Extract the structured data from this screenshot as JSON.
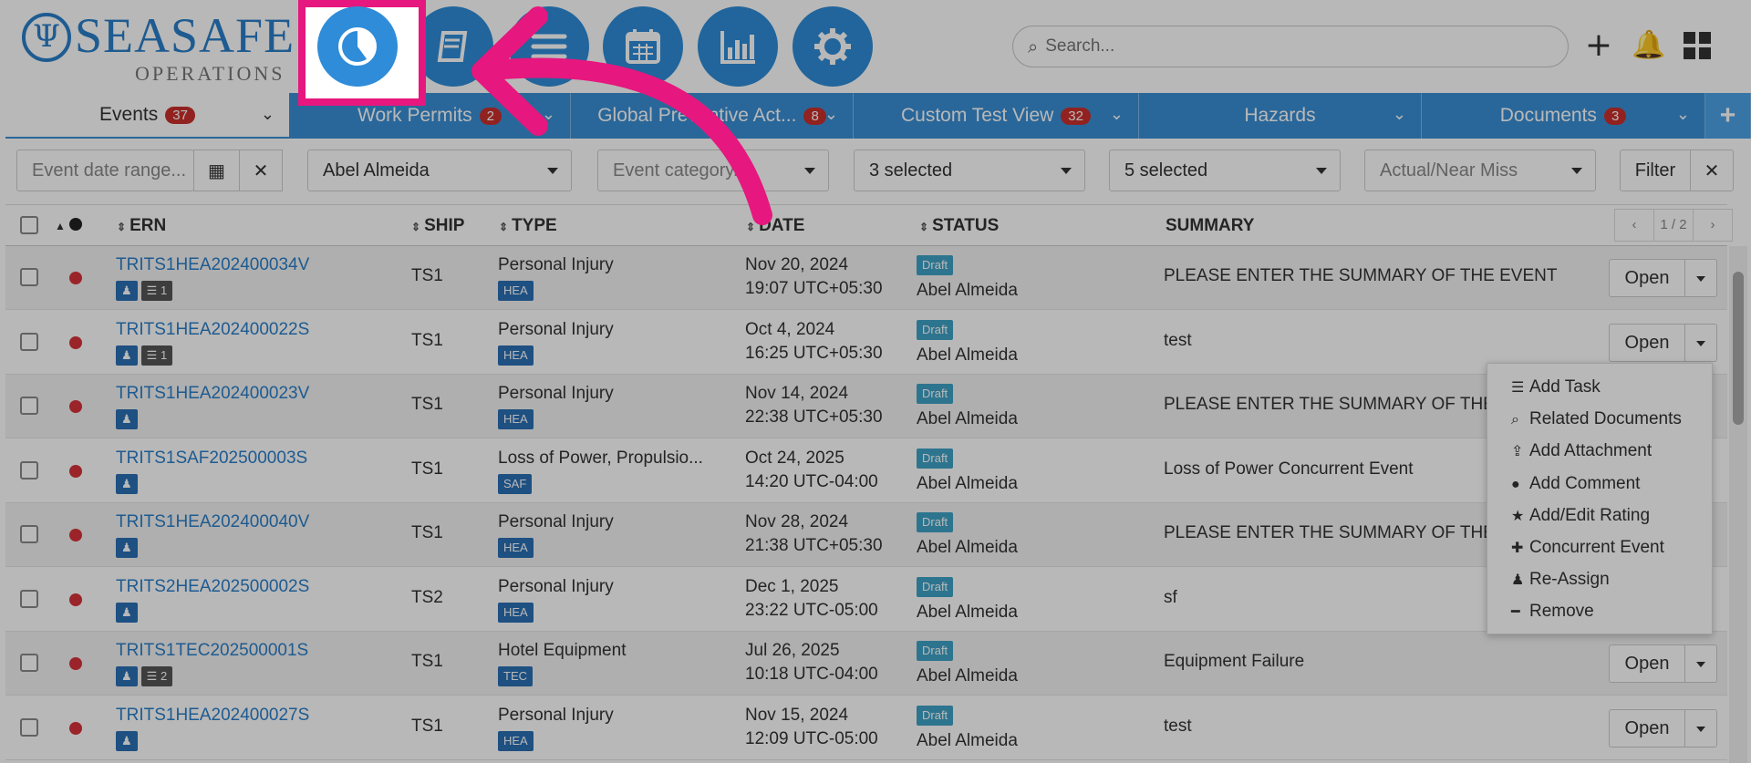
{
  "brand": {
    "name": "SEASAFE",
    "sub": "OPERATIONS"
  },
  "nav_icons": [
    "dashboard-pie-icon",
    "logbook-icon",
    "list-icon",
    "calendar-icon",
    "bar-chart-icon",
    "settings-gear-icon"
  ],
  "search": {
    "placeholder": "Search..."
  },
  "tabs": [
    {
      "label": "Events",
      "count": "37"
    },
    {
      "label": "Work Permits",
      "count": "2"
    },
    {
      "label": "Global Preventive Act...",
      "count": "8"
    },
    {
      "label": "Custom Test View",
      "count": "32"
    },
    {
      "label": "Hazards",
      "count": ""
    },
    {
      "label": "Documents",
      "count": "3"
    }
  ],
  "filters": {
    "date_placeholder": "Event date range...",
    "person": "Abel Almeida",
    "category_placeholder": "Event category...",
    "sel1": "3 selected",
    "sel2": "5 selected",
    "actual_placeholder": "Actual/Near Miss",
    "filter_label": "Filter"
  },
  "columns": {
    "ern": "ERN",
    "ship": "SHIP",
    "type": "TYPE",
    "date": "DATE",
    "status": "STATUS",
    "summary": "SUMMARY"
  },
  "pager": {
    "prev": "‹",
    "pages": "1 / 2",
    "next": "›"
  },
  "rows": [
    {
      "ern": "TRITS1HEA202400034V",
      "ship": "TS1",
      "type": "Personal Injury",
      "type_code": "HEA",
      "date": "Nov 20, 2024",
      "time": "19:07 UTC+05:30",
      "status": "Draft",
      "owner": "Abel Almeida",
      "summary": "PLEASE ENTER THE SUMMARY OF THE EVENT",
      "attach": "1",
      "open": "Open"
    },
    {
      "ern": "TRITS1HEA202400022S",
      "ship": "TS1",
      "type": "Personal Injury",
      "type_code": "HEA",
      "date": "Oct 4, 2024",
      "time": "16:25 UTC+05:30",
      "status": "Draft",
      "owner": "Abel Almeida",
      "summary": "test",
      "attach": "1",
      "open": "Open"
    },
    {
      "ern": "TRITS1HEA202400023V",
      "ship": "TS1",
      "type": "Personal Injury",
      "type_code": "HEA",
      "date": "Nov 14, 2024",
      "time": "22:38 UTC+05:30",
      "status": "Draft",
      "owner": "Abel Almeida",
      "summary": "PLEASE ENTER THE SUMMARY OF THE EV",
      "attach": "",
      "open": ""
    },
    {
      "ern": "TRITS1SAF202500003S",
      "ship": "TS1",
      "type": "Loss of Power, Propulsio...",
      "type_code": "SAF",
      "date": "Oct 24, 2025",
      "time": "14:20 UTC-04:00",
      "status": "Draft",
      "owner": "Abel Almeida",
      "summary": "Loss of Power Concurrent Event",
      "attach": "",
      "open": ""
    },
    {
      "ern": "TRITS1HEA202400040V",
      "ship": "TS1",
      "type": "Personal Injury",
      "type_code": "HEA",
      "date": "Nov 28, 2024",
      "time": "21:38 UTC+05:30",
      "status": "Draft",
      "owner": "Abel Almeida",
      "summary": "PLEASE ENTER THE SUMMARY OF THE EV",
      "attach": "",
      "open": ""
    },
    {
      "ern": "TRITS2HEA202500002S",
      "ship": "TS2",
      "type": "Personal Injury",
      "type_code": "HEA",
      "date": "Dec 1, 2025",
      "time": "23:22 UTC-05:00",
      "status": "Draft",
      "owner": "Abel Almeida",
      "summary": "sf",
      "attach": "",
      "open": ""
    },
    {
      "ern": "TRITS1TEC202500001S",
      "ship": "TS1",
      "type": "Hotel Equipment",
      "type_code": "TEC",
      "date": "Jul 26, 2025",
      "time": "10:18 UTC-04:00",
      "status": "Draft",
      "owner": "Abel Almeida",
      "summary": "Equipment Failure",
      "attach": "2",
      "open": "Open"
    },
    {
      "ern": "TRITS1HEA202400027S",
      "ship": "TS1",
      "type": "Personal Injury",
      "type_code": "HEA",
      "date": "Nov 15, 2024",
      "time": "12:09 UTC-05:00",
      "status": "Draft",
      "owner": "Abel Almeida",
      "summary": "test",
      "attach": "",
      "open": "Open"
    }
  ],
  "menu": [
    {
      "icon": "task-icon",
      "glyph": "☰",
      "label": "Add Task"
    },
    {
      "icon": "search-icon",
      "glyph": "⌕",
      "label": "Related Documents"
    },
    {
      "icon": "upload-icon",
      "glyph": "⇪",
      "label": "Add Attachment"
    },
    {
      "icon": "comment-icon",
      "glyph": "●",
      "label": "Add Comment"
    },
    {
      "icon": "star-icon",
      "glyph": "★",
      "label": "Add/Edit Rating"
    },
    {
      "icon": "plus-icon",
      "glyph": "✚",
      "label": "Concurrent Event"
    },
    {
      "icon": "user-icon",
      "glyph": "♟",
      "label": "Re-Assign"
    },
    {
      "icon": "minus-icon",
      "glyph": "━",
      "label": "Remove"
    }
  ],
  "colors": {
    "accent": "#2f8cd8",
    "annotation": "#e6177e",
    "badge": "#c9302c",
    "status_dot": "#d6333a"
  }
}
